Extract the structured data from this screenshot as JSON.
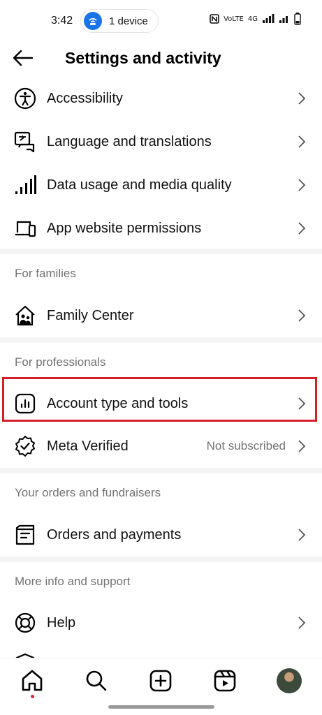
{
  "status_bar": {
    "time": "3:42",
    "device_label": "1 device",
    "network_label": "4G",
    "carrier_label": "VoLTE"
  },
  "header": {
    "title": "Settings and activity"
  },
  "rows": {
    "accessibility": "Accessibility",
    "language": "Language and translations",
    "data_usage": "Data usage and media quality",
    "app_permissions": "App website permissions",
    "family_center": "Family Center",
    "account_type": "Account type and tools",
    "meta_verified": "Meta Verified",
    "meta_verified_status": "Not subscribed",
    "orders": "Orders and payments",
    "help": "Help"
  },
  "sections": {
    "families": "For families",
    "professionals": "For professionals",
    "orders": "Your orders and fundraisers",
    "support": "More info and support"
  },
  "colors": {
    "highlight": "#d32027",
    "muted_text": "#737373",
    "notification_dot": "#e8233c",
    "device_badge": "#1a73e8"
  },
  "bottom_nav": {
    "items": [
      "home-icon",
      "search-icon",
      "create-icon",
      "reels-icon",
      "profile-avatar"
    ],
    "active": "home-icon"
  }
}
